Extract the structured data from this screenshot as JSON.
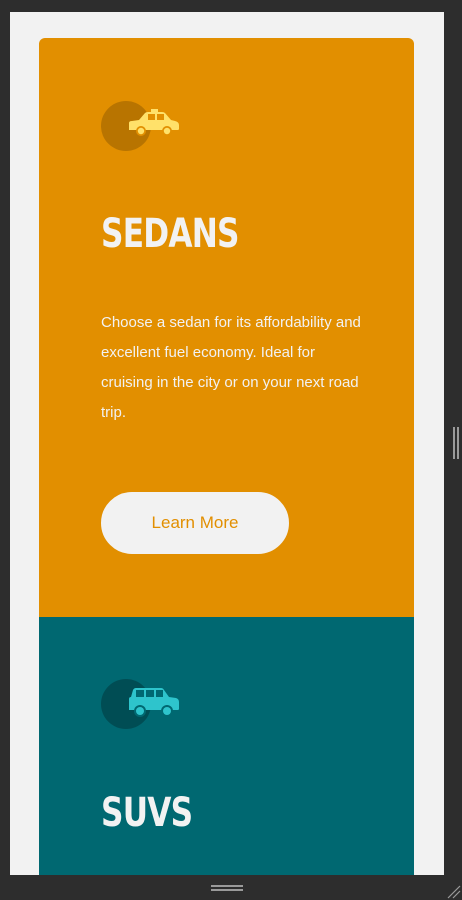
{
  "cards": [
    {
      "title": "Sedans",
      "description": "Choose a sedan for its affordability and excellent fuel economy. Ideal for cruising in the city or on your next road trip.",
      "button_label": "Learn More",
      "icon": "sedan-icon",
      "bg_color": "#e28f00",
      "icon_circle_color": "#b87400",
      "icon_color": "#ffe16a",
      "title_color": "#f2f2f2",
      "text_color": "#f2f2f2",
      "button_text_color": "#e28f00"
    },
    {
      "title": "SUVs",
      "icon": "suv-icon",
      "bg_color": "#006871",
      "icon_circle_color": "#004d54",
      "icon_color": "#2ec4cc",
      "title_color": "#f2f2f2"
    }
  ],
  "colors": {
    "page_bg": "#f2f2f2",
    "frame": "#2d2d2d"
  }
}
